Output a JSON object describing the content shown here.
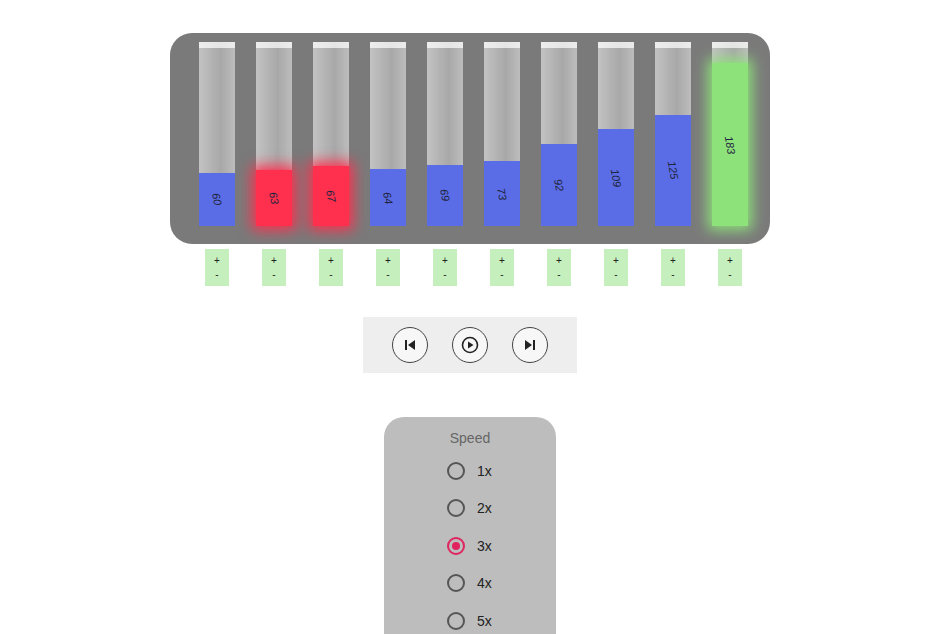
{
  "bars": [
    {
      "value": "60",
      "level": 0.3,
      "state": "default",
      "color": "#5b6de6"
    },
    {
      "value": "63",
      "level": 0.315,
      "state": "compare",
      "color": "#ff2f4e"
    },
    {
      "value": "67",
      "level": 0.335,
      "state": "compare",
      "color": "#ff2f4e"
    },
    {
      "value": "64",
      "level": 0.32,
      "state": "default",
      "color": "#5b6de6"
    },
    {
      "value": "69",
      "level": 0.345,
      "state": "default",
      "color": "#5b6de6"
    },
    {
      "value": "73",
      "level": 0.365,
      "state": "default",
      "color": "#5b6de6"
    },
    {
      "value": "92",
      "level": 0.46,
      "state": "default",
      "color": "#5b6de6"
    },
    {
      "value": "109",
      "level": 0.545,
      "state": "default",
      "color": "#5b6de6"
    },
    {
      "value": "125",
      "level": 0.625,
      "state": "default",
      "color": "#5b6de6"
    },
    {
      "value": "183",
      "level": 0.915,
      "state": "sorted",
      "color": "#8ee27a"
    }
  ],
  "adjust": {
    "plus": "+",
    "minus": "-"
  },
  "speed": {
    "title": "Speed",
    "options": [
      {
        "label": "1x",
        "selected": false
      },
      {
        "label": "2x",
        "selected": false
      },
      {
        "label": "3x",
        "selected": true
      },
      {
        "label": "4x",
        "selected": false
      },
      {
        "label": "5x",
        "selected": false
      }
    ]
  }
}
